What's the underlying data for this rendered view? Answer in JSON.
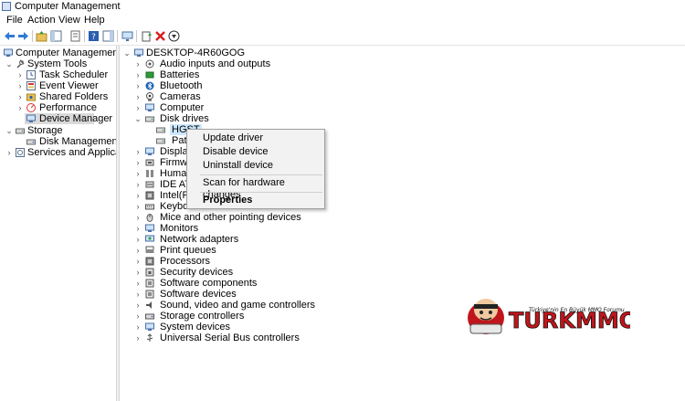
{
  "window": {
    "title": "Computer Management"
  },
  "menu": [
    "File",
    "Action",
    "View",
    "Help"
  ],
  "left_tree": {
    "root": "Computer Management (Local",
    "system_tools": "System Tools",
    "task_scheduler": "Task Scheduler",
    "event_viewer": "Event Viewer",
    "shared_folders": "Shared Folders",
    "performance": "Performance",
    "device_manager": "Device Manager",
    "storage": "Storage",
    "disk_management": "Disk Management",
    "services": "Services and Applications"
  },
  "device_tree": {
    "computer_name": "DESKTOP-4R60GOG",
    "categories": [
      "Audio inputs and outputs",
      "Batteries",
      "Bluetooth",
      "Cameras",
      "Computer",
      "Disk drives",
      "HGST",
      "Patr",
      "Display",
      "Firmwa",
      "Human",
      "IDE ATA",
      "Intel(R)",
      "Keyboards",
      "Mice and other pointing devices",
      "Monitors",
      "Network adapters",
      "Print queues",
      "Processors",
      "Security devices",
      "Software components",
      "Software devices",
      "Sound, video and game controllers",
      "Storage controllers",
      "System devices",
      "Universal Serial Bus controllers"
    ]
  },
  "context_menu": {
    "update": "Update driver",
    "disable": "Disable device",
    "uninstall": "Uninstall device",
    "scan": "Scan for hardware changes",
    "properties": "Properties"
  },
  "watermark": {
    "brand": "TURKMMO",
    "tagline": "Türkiye'nin En Büyük MMO Forumu"
  },
  "colors": {
    "selection": "#cce8ff",
    "accent": "#1a5fb4",
    "watermark_red": "#c0161b"
  }
}
